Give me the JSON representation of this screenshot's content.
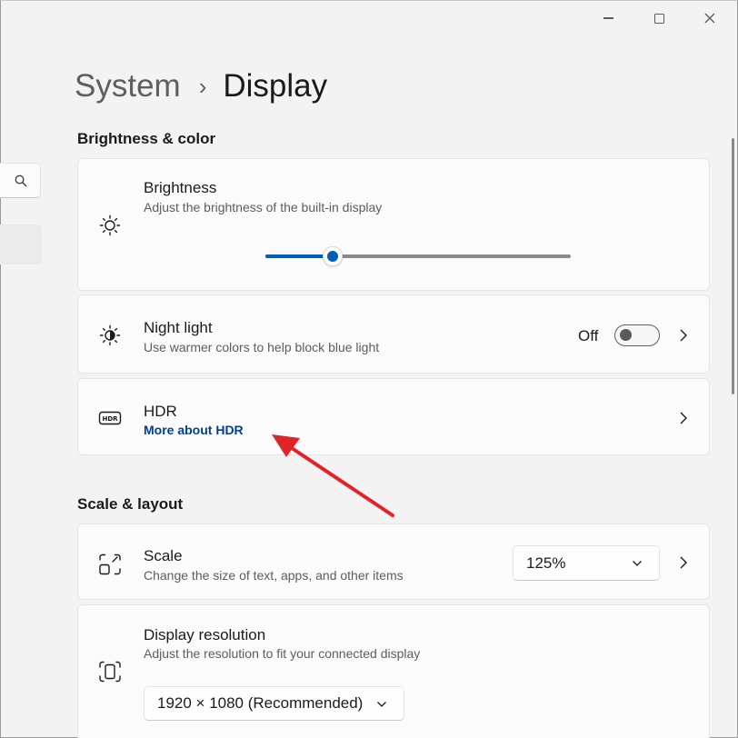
{
  "window": {
    "controls": [
      "minimize-icon",
      "maximize-icon",
      "close-icon"
    ]
  },
  "nav": {
    "search_icon": "search-icon"
  },
  "breadcrumb": {
    "parent": "System",
    "separator": "›",
    "current": "Display"
  },
  "sections": {
    "brightness_color": "Brightness & color",
    "scale_layout": "Scale & layout"
  },
  "brightness": {
    "icon": "sun-icon",
    "title": "Brightness",
    "subtitle": "Adjust the brightness of the built-in display",
    "value_fraction": 0.22
  },
  "night_light": {
    "icon": "night-light-icon",
    "title": "Night light",
    "subtitle": "Use warmer colors to help block blue light",
    "state_label": "Off",
    "enabled": false
  },
  "hdr": {
    "icon": "hdr-icon",
    "title": "HDR",
    "link": "More about HDR"
  },
  "scale": {
    "icon": "scale-icon",
    "title": "Scale",
    "subtitle": "Change the size of text, apps, and other items",
    "selected": "125%"
  },
  "resolution": {
    "icon": "display-resolution-icon",
    "title": "Display resolution",
    "subtitle": "Adjust the resolution to fit your connected display",
    "selected": "1920 × 1080 (Recommended)"
  },
  "colors": {
    "accent": "#005fb8",
    "link": "#003e92",
    "annotation_arrow": "#e0242a"
  }
}
